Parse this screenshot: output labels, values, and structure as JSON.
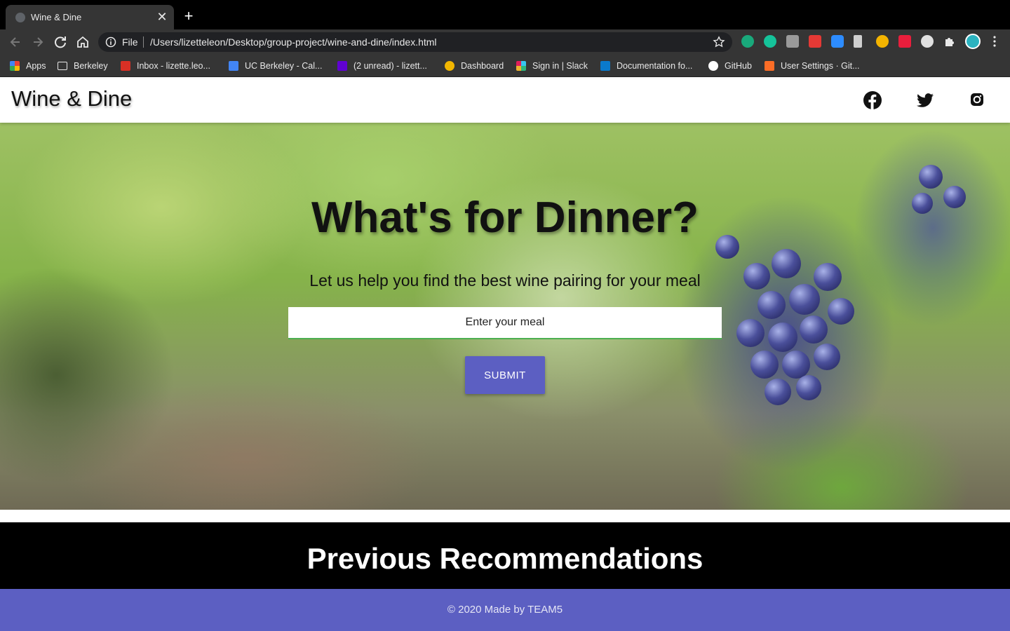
{
  "browser": {
    "tab_title": "Wine & Dine",
    "close_glyph": "✕",
    "newtab_glyph": "+",
    "file_label": "File",
    "url": "/Users/lizetteleon/Desktop/group-project/wine-and-dine/index.html",
    "bookmarks": [
      {
        "label": "Apps",
        "icon": "apps-grid-icon",
        "color": "#ea4335"
      },
      {
        "label": "Berkeley",
        "icon": "folder-icon",
        "color": "#9aa0a6"
      },
      {
        "label": "Inbox - lizette.leo...",
        "icon": "gmail-icon",
        "color": "#d93025"
      },
      {
        "label": "UC Berkeley - Cal...",
        "icon": "calendar-icon",
        "color": "#4285f4"
      },
      {
        "label": "(2 unread) - lizett...",
        "icon": "yahoo-mail-icon",
        "color": "#6001d2"
      },
      {
        "label": "Dashboard",
        "icon": "dashboard-icon",
        "color": "#f2b600"
      },
      {
        "label": "Sign in | Slack",
        "icon": "slack-icon",
        "color": "#e01e5a"
      },
      {
        "label": "Documentation fo...",
        "icon": "vscode-icon",
        "color": "#0a7acc"
      },
      {
        "label": "GitHub",
        "icon": "github-icon",
        "color": "#ffffff"
      },
      {
        "label": "User Settings · Git...",
        "icon": "gitlab-icon",
        "color": "#fc6d26"
      }
    ]
  },
  "site": {
    "brand": "Wine & Dine",
    "social": [
      "facebook-icon",
      "twitter-icon",
      "instagram-icon"
    ]
  },
  "hero": {
    "title": "What's for Dinner?",
    "subtitle": "Let us help you find the best wine pairing for your meal",
    "input_placeholder": "Enter your meal",
    "submit_label": "SUBMIT"
  },
  "previous": {
    "title": "Previous Recommendations"
  },
  "footer": {
    "text": "© 2020 Made by TEAM5"
  },
  "colors": {
    "accent": "#5c5fc2",
    "input_underline": "#4caf50"
  }
}
